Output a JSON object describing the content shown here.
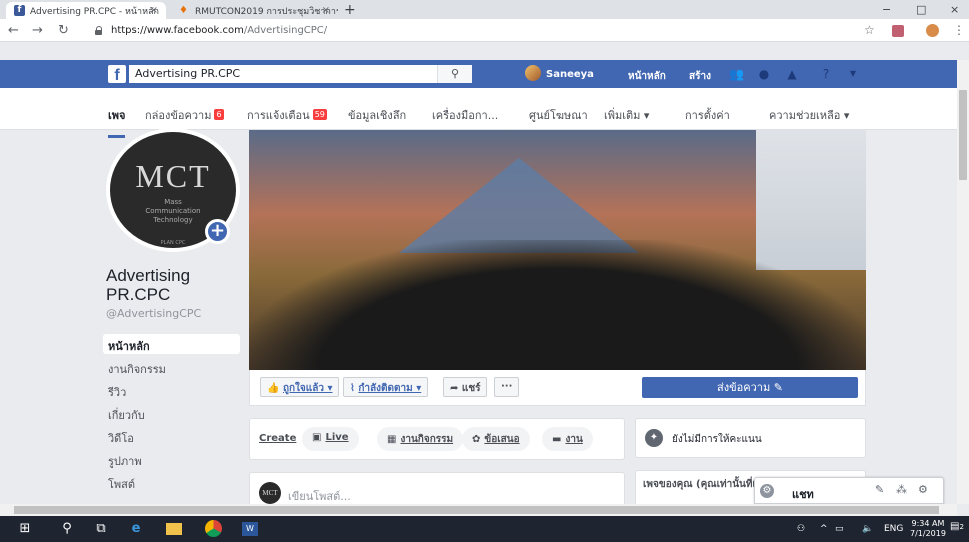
{
  "browser": {
    "tabs": [
      {
        "title": "Advertising PR.CPC - หน้าหลัก",
        "active": true
      },
      {
        "title": "RMUTCON2019 การประชุมวิชาการ",
        "active": false
      }
    ],
    "new_tab": "+",
    "window_controls": [
      "−",
      "□",
      "×"
    ],
    "url_host": "https://www.facebook.com",
    "url_path": "/AdvertisingCPC/"
  },
  "fb_header": {
    "logo": "f",
    "search_value": "Advertising PR.CPC",
    "search_icon": "⚲",
    "user_name": "Saneeya",
    "nav": [
      "หน้าหลัก",
      "สร้าง"
    ],
    "icons": [
      "friends-icon",
      "messenger-icon",
      "notifications-icon",
      "help-icon",
      "dropdown-icon"
    ]
  },
  "page_tabs": [
    {
      "label": "เพจ",
      "active": true
    },
    {
      "label": "กล่องข้อความ",
      "badge": "6"
    },
    {
      "label": "การแจ้งเตือน",
      "badge": "59"
    },
    {
      "label": "ข้อมูลเชิงลึก"
    },
    {
      "label": "เครื่องมือกา..."
    },
    {
      "label": "ศูนย์โฆษณา"
    },
    {
      "label": "เพิ่มเติม ▾"
    },
    {
      "label": "การตั้งค่า"
    },
    {
      "label": "ความช่วยเหลือ ▾"
    }
  ],
  "profile": {
    "logo_text": "MCT",
    "logo_sub": "Mass\nCommunication\nTechnology",
    "logo_tiny": "PLAN CPC",
    "add_photo": "+",
    "page_name": "Advertising PR.CPC",
    "handle": "@AdvertisingCPC"
  },
  "left_nav": [
    {
      "label": "หน้าหลัก",
      "active": true
    },
    {
      "label": "งานกิจกรรม"
    },
    {
      "label": "รีวิว"
    },
    {
      "label": "เกี่ยวกับ"
    },
    {
      "label": "วิดีโอ"
    },
    {
      "label": "รูปภาพ"
    },
    {
      "label": "โพสต์"
    }
  ],
  "cover_actions": {
    "like": "ถูกใจแล้ว ▾",
    "follow": "กำลังติดตาม ▾",
    "share": "แชร์",
    "more": "···",
    "send_message": "ส่งข้อความ ✎"
  },
  "create_bar": {
    "label": "Create",
    "items": [
      "Live",
      "งานกิจกรรม",
      "ข้อเสนอ",
      "งาน"
    ]
  },
  "composer": {
    "avatar": "MCT",
    "placeholder": "เขียนโพสต์..."
  },
  "ratings": {
    "text": "ยังไม่มีการให้คะแนน"
  },
  "your_pages": {
    "title": "เพจของคุณ (คุณเท่านั้นที่เห็น)"
  },
  "chat": {
    "label": "แชท"
  },
  "taskbar": {
    "tray_lang": "ENG",
    "time": "9:34 AM",
    "date": "7/1/2019",
    "notif_count": "2"
  },
  "colors": {
    "fb_blue": "#4267b2",
    "badge_red": "#fa3e3e"
  }
}
